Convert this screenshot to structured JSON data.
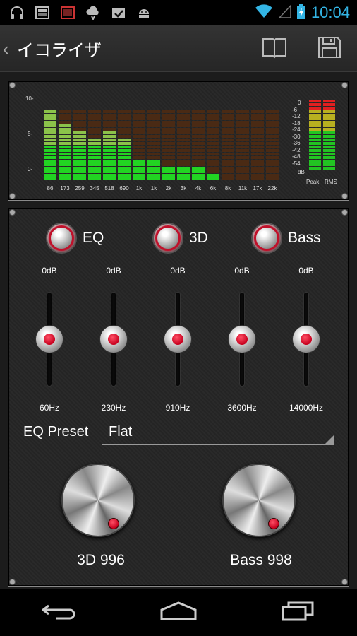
{
  "status_bar": {
    "time": "10:04",
    "left_icons": [
      "headphones-icon",
      "sd-card-icon",
      "media-icon",
      "cloud-sync-icon",
      "task-done-icon",
      "android-icon"
    ],
    "right_icons": [
      "wifi-icon",
      "signal-icon",
      "battery-charging-icon"
    ]
  },
  "action_bar": {
    "back_glyph": "‹",
    "title": "イコライザ",
    "icons": [
      "book-icon",
      "save-icon"
    ]
  },
  "spectrum": {
    "y_ticks": [
      "10-",
      "5-",
      "0-"
    ],
    "bands": [
      {
        "label": "86",
        "level": 10
      },
      {
        "label": "173",
        "level": 8
      },
      {
        "label": "259",
        "level": 7
      },
      {
        "label": "345",
        "level": 6
      },
      {
        "label": "518",
        "level": 7
      },
      {
        "label": "690",
        "level": 6
      },
      {
        "label": "1k",
        "level": 3
      },
      {
        "label": "1k",
        "level": 3
      },
      {
        "label": "2k",
        "level": 2
      },
      {
        "label": "3k",
        "level": 2
      },
      {
        "label": "4k",
        "level": 2
      },
      {
        "label": "6k",
        "level": 1
      },
      {
        "label": "8k",
        "level": 0
      },
      {
        "label": "11k",
        "level": 0
      },
      {
        "label": "17k",
        "level": 0
      },
      {
        "label": "22k",
        "level": 0
      }
    ],
    "db_scale": [
      "0",
      "-6",
      "-12",
      "-18",
      "-24",
      "-30",
      "-36",
      "-42",
      "-48",
      "-54"
    ],
    "db_unit": "dB",
    "peak_label": "Peak",
    "rms_label": "RMS"
  },
  "toggles": [
    {
      "label": "EQ"
    },
    {
      "label": "3D"
    },
    {
      "label": "Bass"
    }
  ],
  "eq_bands": [
    {
      "gain": "0dB",
      "freq": "60Hz",
      "level": 0.5
    },
    {
      "gain": "0dB",
      "freq": "230Hz",
      "level": 0.5
    },
    {
      "gain": "0dB",
      "freq": "910Hz",
      "level": 0.5
    },
    {
      "gain": "0dB",
      "freq": "3600Hz",
      "level": 0.5
    },
    {
      "gain": "0dB",
      "freq": "14000Hz",
      "level": 0.5
    }
  ],
  "preset": {
    "label": "EQ Preset",
    "value": "Flat"
  },
  "knobs": [
    {
      "label": "3D 996"
    },
    {
      "label": "Bass 998"
    }
  ],
  "nav_bar": {
    "icons": [
      "back-icon",
      "home-icon",
      "recents-icon"
    ]
  }
}
